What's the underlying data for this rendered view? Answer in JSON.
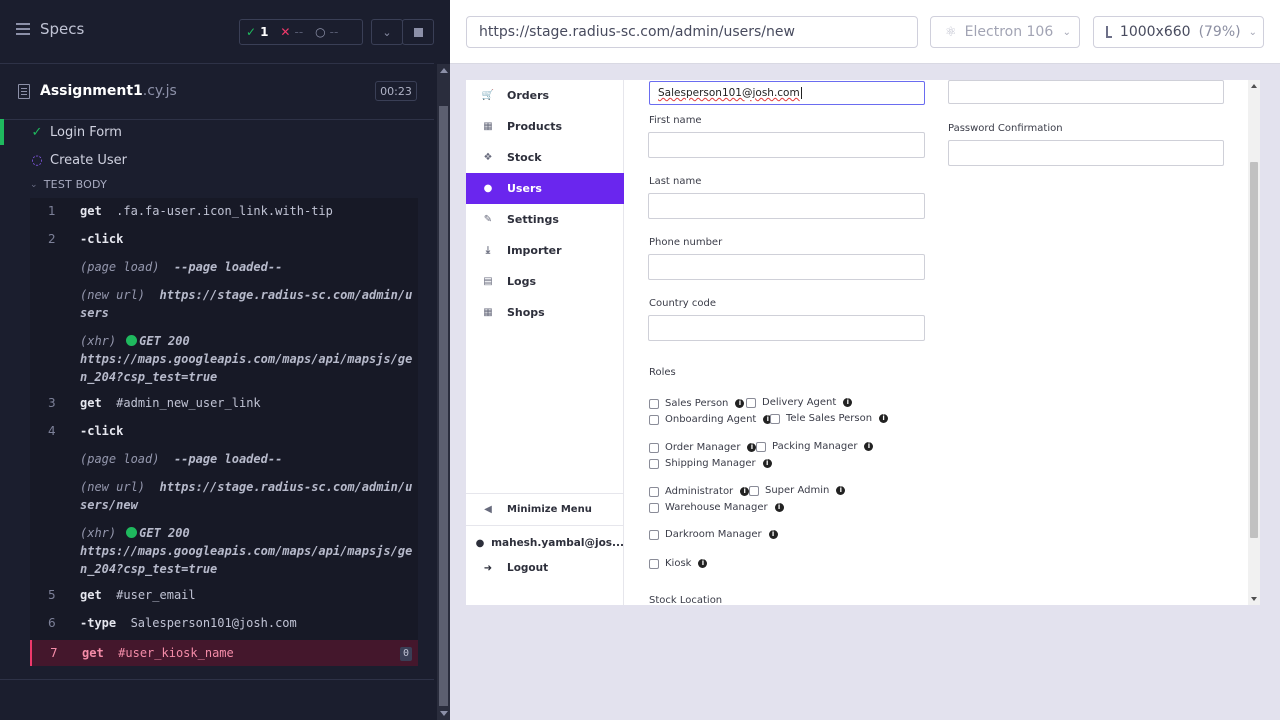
{
  "runner": {
    "title": "Specs",
    "stats": {
      "passed": "1",
      "failed": "--",
      "pending": "--"
    },
    "spec_file": {
      "name": "Assignment1",
      "ext": ".cy.js",
      "duration": "00:23"
    },
    "suites": [
      {
        "label": "Login Form",
        "status": "passed"
      },
      {
        "label": "Create User",
        "status": "running"
      }
    ],
    "test_body_label": "TEST BODY",
    "commands": [
      {
        "num": "1",
        "name": "get",
        "arg": " .fa.fa-user.icon_link.with-tip"
      },
      {
        "num": "2",
        "name": "-click",
        "arg": ""
      },
      {
        "num": "",
        "event": "(page load)",
        "text": "--page loaded--"
      },
      {
        "num": "",
        "event": "(new url)",
        "text": "https://stage.radius-sc.com/admin/users"
      },
      {
        "num": "",
        "event": "(xhr)",
        "method": "GET 200",
        "text": "https://maps.googleapis.com/maps/api/mapsjs/gen_204?csp_test=true"
      },
      {
        "num": "3",
        "name": "get",
        "arg": " #admin_new_user_link"
      },
      {
        "num": "4",
        "name": "-click",
        "arg": ""
      },
      {
        "num": "",
        "event": "(page load)",
        "text": "--page loaded--"
      },
      {
        "num": "",
        "event": "(new url)",
        "text": "https://stage.radius-sc.com/admin/users/new"
      },
      {
        "num": "",
        "event": "(xhr)",
        "method": "GET 200",
        "text": "https://maps.googleapis.com/maps/api/mapsjs/gen_204?csp_test=true"
      },
      {
        "num": "5",
        "name": "get",
        "arg": " #user_email"
      },
      {
        "num": "6",
        "name": "-type",
        "arg": " Salesperson101@josh.com"
      },
      {
        "num": "7",
        "name": "get",
        "arg": " #user_kiosk_name",
        "badge": "0"
      }
    ]
  },
  "aut_header": {
    "url": "https://stage.radius-sc.com/admin/users/new",
    "browser": "Electron 106",
    "viewport": "1000x660",
    "zoom": "(79%)"
  },
  "app": {
    "nav": [
      {
        "label": "Orders",
        "icon": "cart-icon"
      },
      {
        "label": "Products",
        "icon": "grid-icon"
      },
      {
        "label": "Stock",
        "icon": "cubes-icon"
      },
      {
        "label": "Users",
        "icon": "user-icon",
        "active": true
      },
      {
        "label": "Settings",
        "icon": "wrench-icon"
      },
      {
        "label": "Importer",
        "icon": "download-icon"
      },
      {
        "label": "Logs",
        "icon": "file-icon"
      },
      {
        "label": "Shops",
        "icon": "grid-icon"
      }
    ],
    "minimize_label": "Minimize Menu",
    "account_email": "mahesh.yambal@jos...",
    "logout_label": "Logout",
    "form": {
      "email_value": "Salesperson101@josh.com",
      "first_name_label": "First name",
      "last_name_label": "Last name",
      "phone_label": "Phone number",
      "country_label": "Country code",
      "password_confirm_label": "Password Confirmation",
      "roles_label": "Roles",
      "roles": [
        "Sales Person",
        "Delivery Agent",
        "Onboarding Agent",
        "Tele Sales Person",
        "Order Manager",
        "Packing Manager",
        "Shipping Manager",
        "Administrator",
        "Super Admin",
        "Warehouse Manager",
        "Darkroom Manager",
        "Kiosk"
      ],
      "stock_location_label": "Stock Location"
    }
  }
}
